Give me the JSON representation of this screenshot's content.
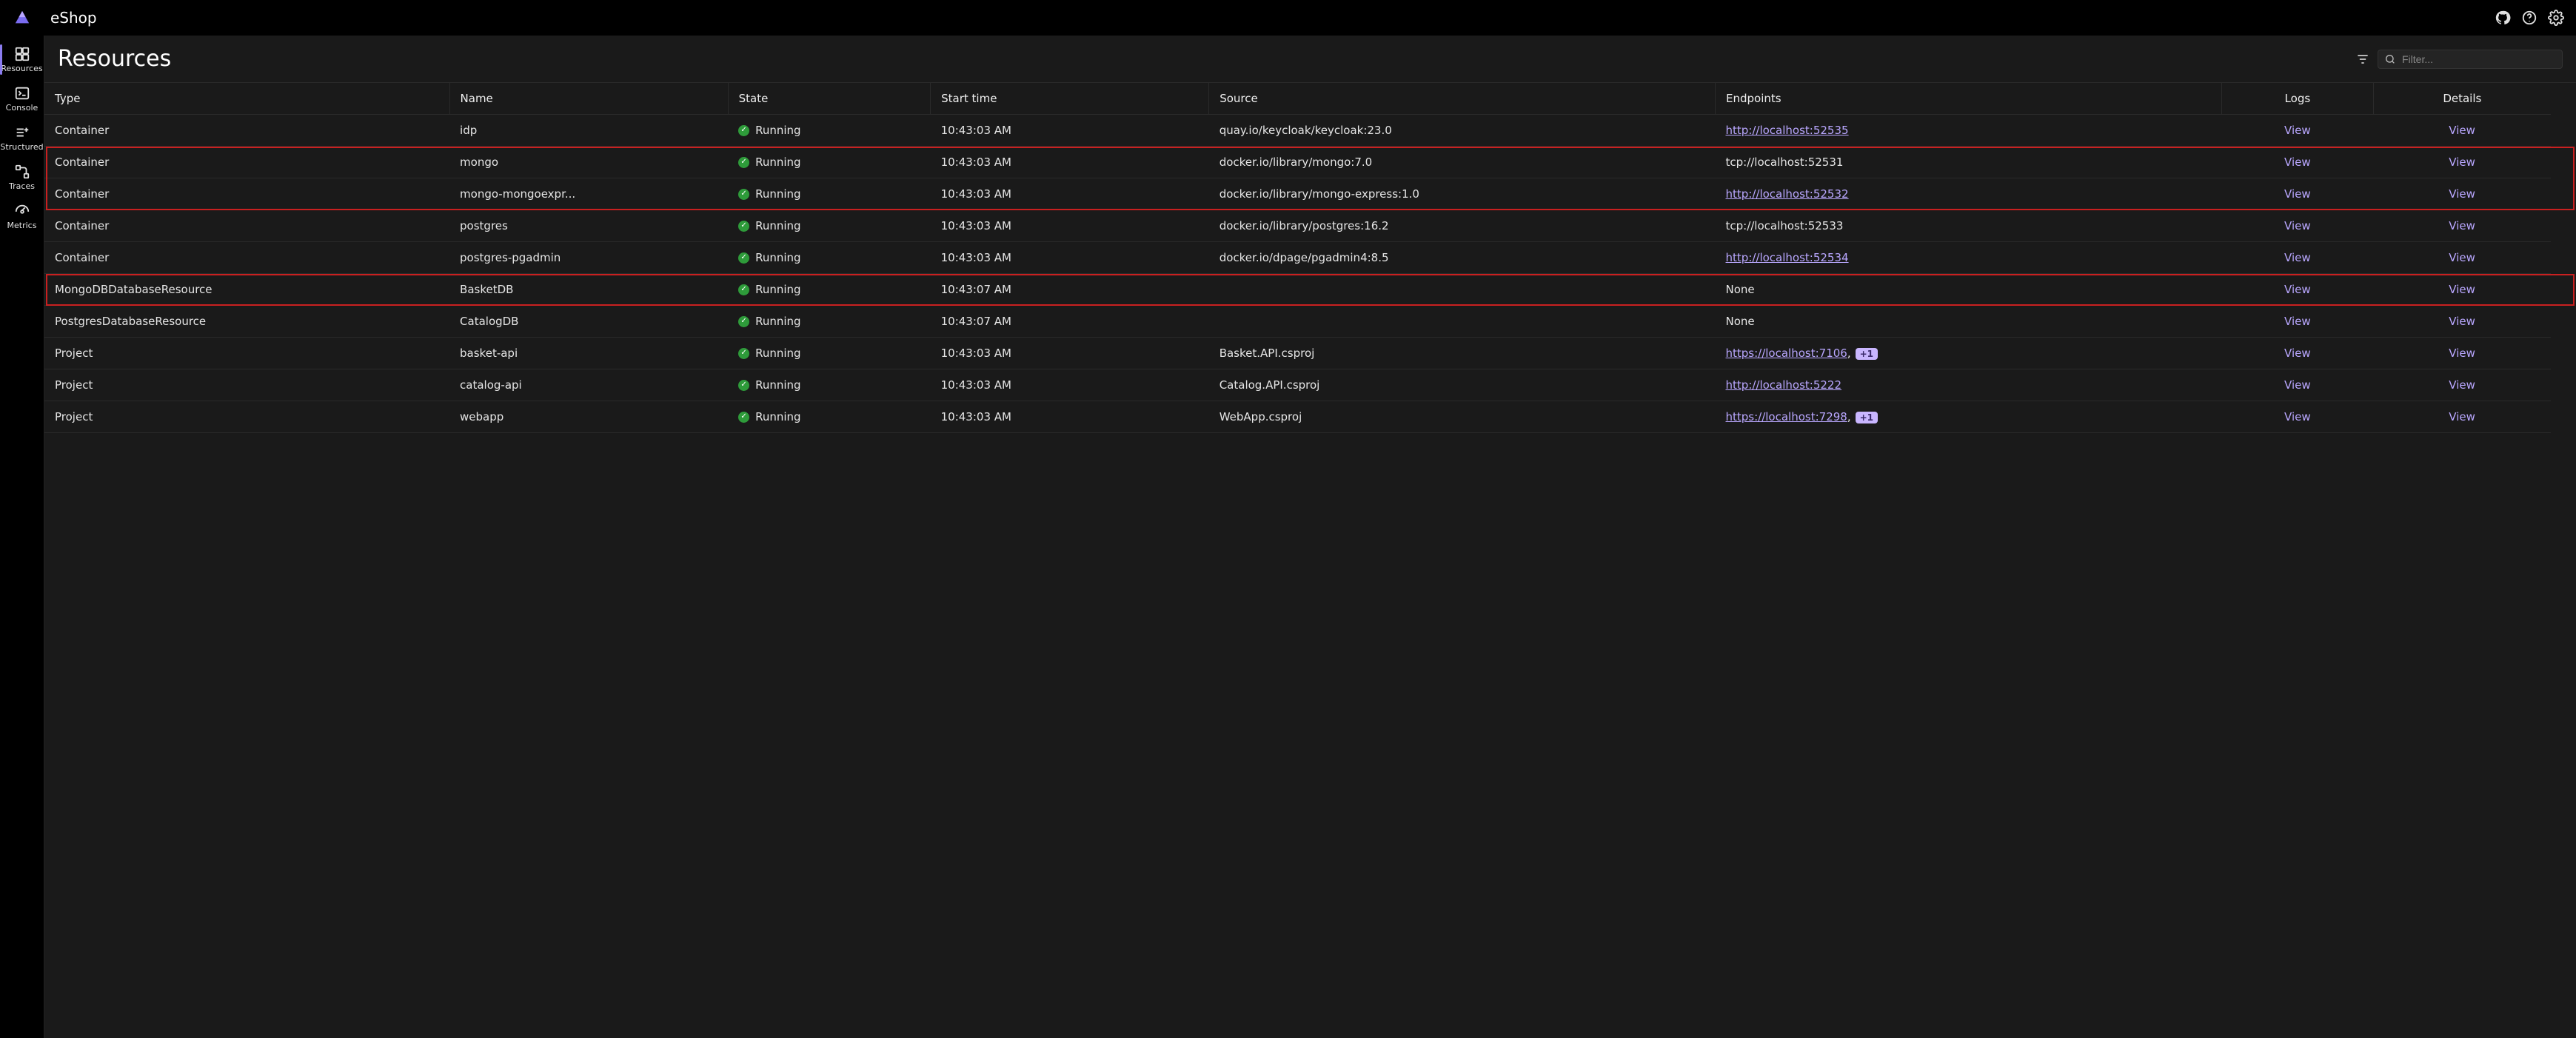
{
  "app": {
    "title": "eShop"
  },
  "page": {
    "title": "Resources"
  },
  "search": {
    "placeholder": "Filter..."
  },
  "sidebar": {
    "items": [
      {
        "label": "Resources",
        "icon": "grid"
      },
      {
        "label": "Console",
        "icon": "terminal"
      },
      {
        "label": "Structured",
        "icon": "list-plus"
      },
      {
        "label": "Traces",
        "icon": "flow"
      },
      {
        "label": "Metrics",
        "icon": "gauge"
      }
    ]
  },
  "columns": {
    "type": "Type",
    "name": "Name",
    "state": "State",
    "start": "Start time",
    "source": "Source",
    "endpoints": "Endpoints",
    "logs": "Logs",
    "details": "Details"
  },
  "labels": {
    "logs_view": "View",
    "details_view": "View"
  },
  "rows": [
    {
      "type": "Container",
      "name": "idp",
      "state": "Running",
      "start": "10:43:03 AM",
      "source": "quay.io/keycloak/keycloak:23.0",
      "endpoint_text": "http://localhost:52535",
      "endpoint_link": true
    },
    {
      "type": "Container",
      "name": "mongo",
      "state": "Running",
      "start": "10:43:03 AM",
      "source": "docker.io/library/mongo:7.0",
      "endpoint_text": "tcp://localhost:52531",
      "endpoint_link": false
    },
    {
      "type": "Container",
      "name": "mongo-mongoexpr...",
      "state": "Running",
      "start": "10:43:03 AM",
      "source": "docker.io/library/mongo-express:1.0",
      "endpoint_text": "http://localhost:52532",
      "endpoint_link": true
    },
    {
      "type": "Container",
      "name": "postgres",
      "state": "Running",
      "start": "10:43:03 AM",
      "source": "docker.io/library/postgres:16.2",
      "endpoint_text": "tcp://localhost:52533",
      "endpoint_link": false
    },
    {
      "type": "Container",
      "name": "postgres-pgadmin",
      "state": "Running",
      "start": "10:43:03 AM",
      "source": "docker.io/dpage/pgadmin4:8.5",
      "endpoint_text": "http://localhost:52534",
      "endpoint_link": true
    },
    {
      "type": "MongoDBDatabaseResource",
      "name": "BasketDB",
      "state": "Running",
      "start": "10:43:07 AM",
      "source": "",
      "endpoint_text": "None",
      "endpoint_link": false
    },
    {
      "type": "PostgresDatabaseResource",
      "name": "CatalogDB",
      "state": "Running",
      "start": "10:43:07 AM",
      "source": "",
      "endpoint_text": "None",
      "endpoint_link": false
    },
    {
      "type": "Project",
      "name": "basket-api",
      "state": "Running",
      "start": "10:43:03 AM",
      "source": "Basket.API.csproj",
      "endpoint_text": "https://localhost:7106",
      "endpoint_link": true,
      "endpoint_more": "+1",
      "endpoint_comma": ","
    },
    {
      "type": "Project",
      "name": "catalog-api",
      "state": "Running",
      "start": "10:43:03 AM",
      "source": "Catalog.API.csproj",
      "endpoint_text": "http://localhost:5222",
      "endpoint_link": true
    },
    {
      "type": "Project",
      "name": "webapp",
      "state": "Running",
      "start": "10:43:03 AM",
      "source": "WebApp.csproj",
      "endpoint_text": "https://localhost:7298",
      "endpoint_link": true,
      "endpoint_more": "+1",
      "endpoint_comma": ","
    }
  ],
  "highlights": {
    "groupA": [
      1,
      2
    ],
    "groupB": [
      5
    ]
  }
}
